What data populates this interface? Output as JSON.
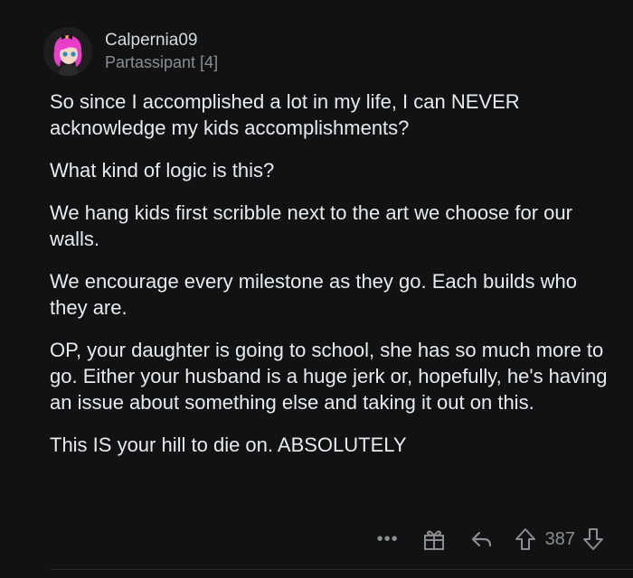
{
  "user": {
    "username": "Calpernia09",
    "flair": "Partassipant [4]"
  },
  "comment": {
    "paragraphs": [
      "So since I accomplished a lot in my life, I can NEVER acknowledge my kids accomplishments?",
      "What kind of logic is this?",
      "We hang kids first scribble next to the art we choose for our walls.",
      "We encourage every milestone as they go. Each builds who they are.",
      "OP, your daughter is going to school, she has so much more to go. Either your husband is a huge jerk or, hopefully, he's having an issue about something else and taking it out on this.",
      "This IS your hill to die on.  ABSOLUTELY"
    ]
  },
  "actions": {
    "more": "•••",
    "vote_count": "387"
  },
  "icons": {
    "more": "more-icon",
    "award": "gift-icon",
    "reply": "reply-icon",
    "upvote": "upvote-icon",
    "downvote": "downvote-icon"
  },
  "colors": {
    "background": "#121212",
    "text": "#e8eaed",
    "muted": "#8b8d90",
    "avatar_hair": "#e83ec8"
  }
}
